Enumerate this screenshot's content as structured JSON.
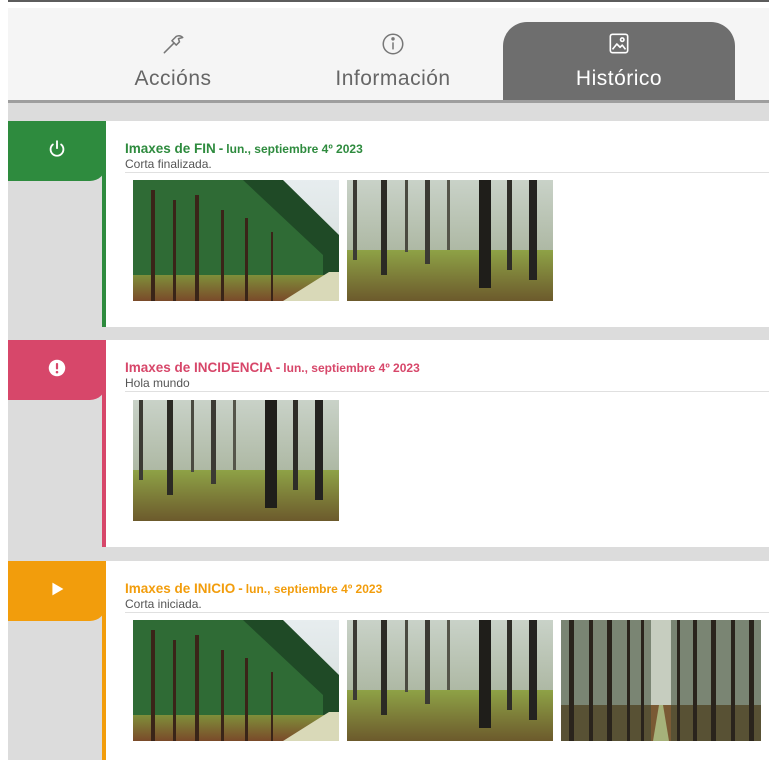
{
  "tabs": {
    "actions": {
      "label": "Accións",
      "icon": "hammer-icon"
    },
    "info": {
      "label": "Información",
      "icon": "info-circle-icon"
    },
    "history": {
      "label": "Histórico",
      "icon": "image-gallery-icon"
    }
  },
  "entries": [
    {
      "title": "Imaxes de FIN",
      "separator": "-",
      "date": "lun., septiembre 4º 2023",
      "subtitle": "Corta finalizada.",
      "color": "#2e8b3e",
      "icon": "power-icon",
      "images": [
        "pine-forest-road-photo",
        "pine-forest-undergrowth-photo"
      ]
    },
    {
      "title": "Imaxes de INCIDENCIA",
      "separator": "-",
      "date": "lun., septiembre 4º 2023",
      "subtitle": "Hola mundo",
      "color": "#d7476a",
      "icon": "alert-icon",
      "images": [
        "pine-forest-undergrowth-photo"
      ]
    },
    {
      "title": "Imaxes de INICIO",
      "separator": "-",
      "date": "lun., septiembre 4º 2023",
      "subtitle": "Corta iniciada.",
      "color": "#f29d0c",
      "icon": "play-icon",
      "images": [
        "pine-forest-road-photo",
        "pine-forest-undergrowth-photo",
        "pine-forest-path-photo"
      ]
    }
  ]
}
